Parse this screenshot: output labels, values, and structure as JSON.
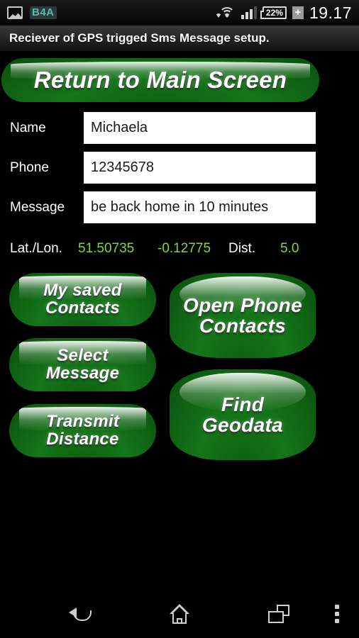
{
  "status_bar": {
    "left_icons": [
      {
        "name": "screenshot-image-icon",
        "label": ""
      },
      {
        "name": "b4a-app-icon",
        "label": "B4A"
      }
    ],
    "wifi_icon": "wifi-icon",
    "signal_icon": "cellular-signal-icon",
    "battery_percent": "22%",
    "battery_charging_icon": "+",
    "clock": "19.17"
  },
  "title_bar": {
    "title": "Reciever of GPS trigged Sms Message setup."
  },
  "buttons": {
    "return_main": "Return to Main Screen",
    "my_saved_contacts_line1": "My saved",
    "my_saved_contacts_line2": "Contacts",
    "select_message_line1": "Select",
    "select_message_line2": "Message",
    "transmit_distance_line1": "Transmit",
    "transmit_distance_line2": "Distance",
    "open_phone_contacts_line1": "Open Phone",
    "open_phone_contacts_line2": "Contacts",
    "find_geodata_line1": "Find",
    "find_geodata_line2": "Geodata"
  },
  "form": {
    "name_label": "Name",
    "name_value": "Michaela",
    "phone_label": "Phone",
    "phone_value": "12345678",
    "message_label": "Message",
    "message_value": "be back home in 10 minutes"
  },
  "coords": {
    "latlon_label": "Lat./Lon.",
    "latitude": "51.50735",
    "longitude": "-0.12775",
    "dist_label": "Dist.",
    "dist_value": "5.0"
  },
  "nav_bar": {
    "back": "back-icon",
    "home": "home-icon",
    "recent": "recent-apps-icon",
    "menu": "overflow-menu-icon"
  },
  "colors": {
    "button_green": "#15761a",
    "coord_green": "#7ddb33",
    "background": "#000000",
    "field_white": "#ffffff"
  }
}
